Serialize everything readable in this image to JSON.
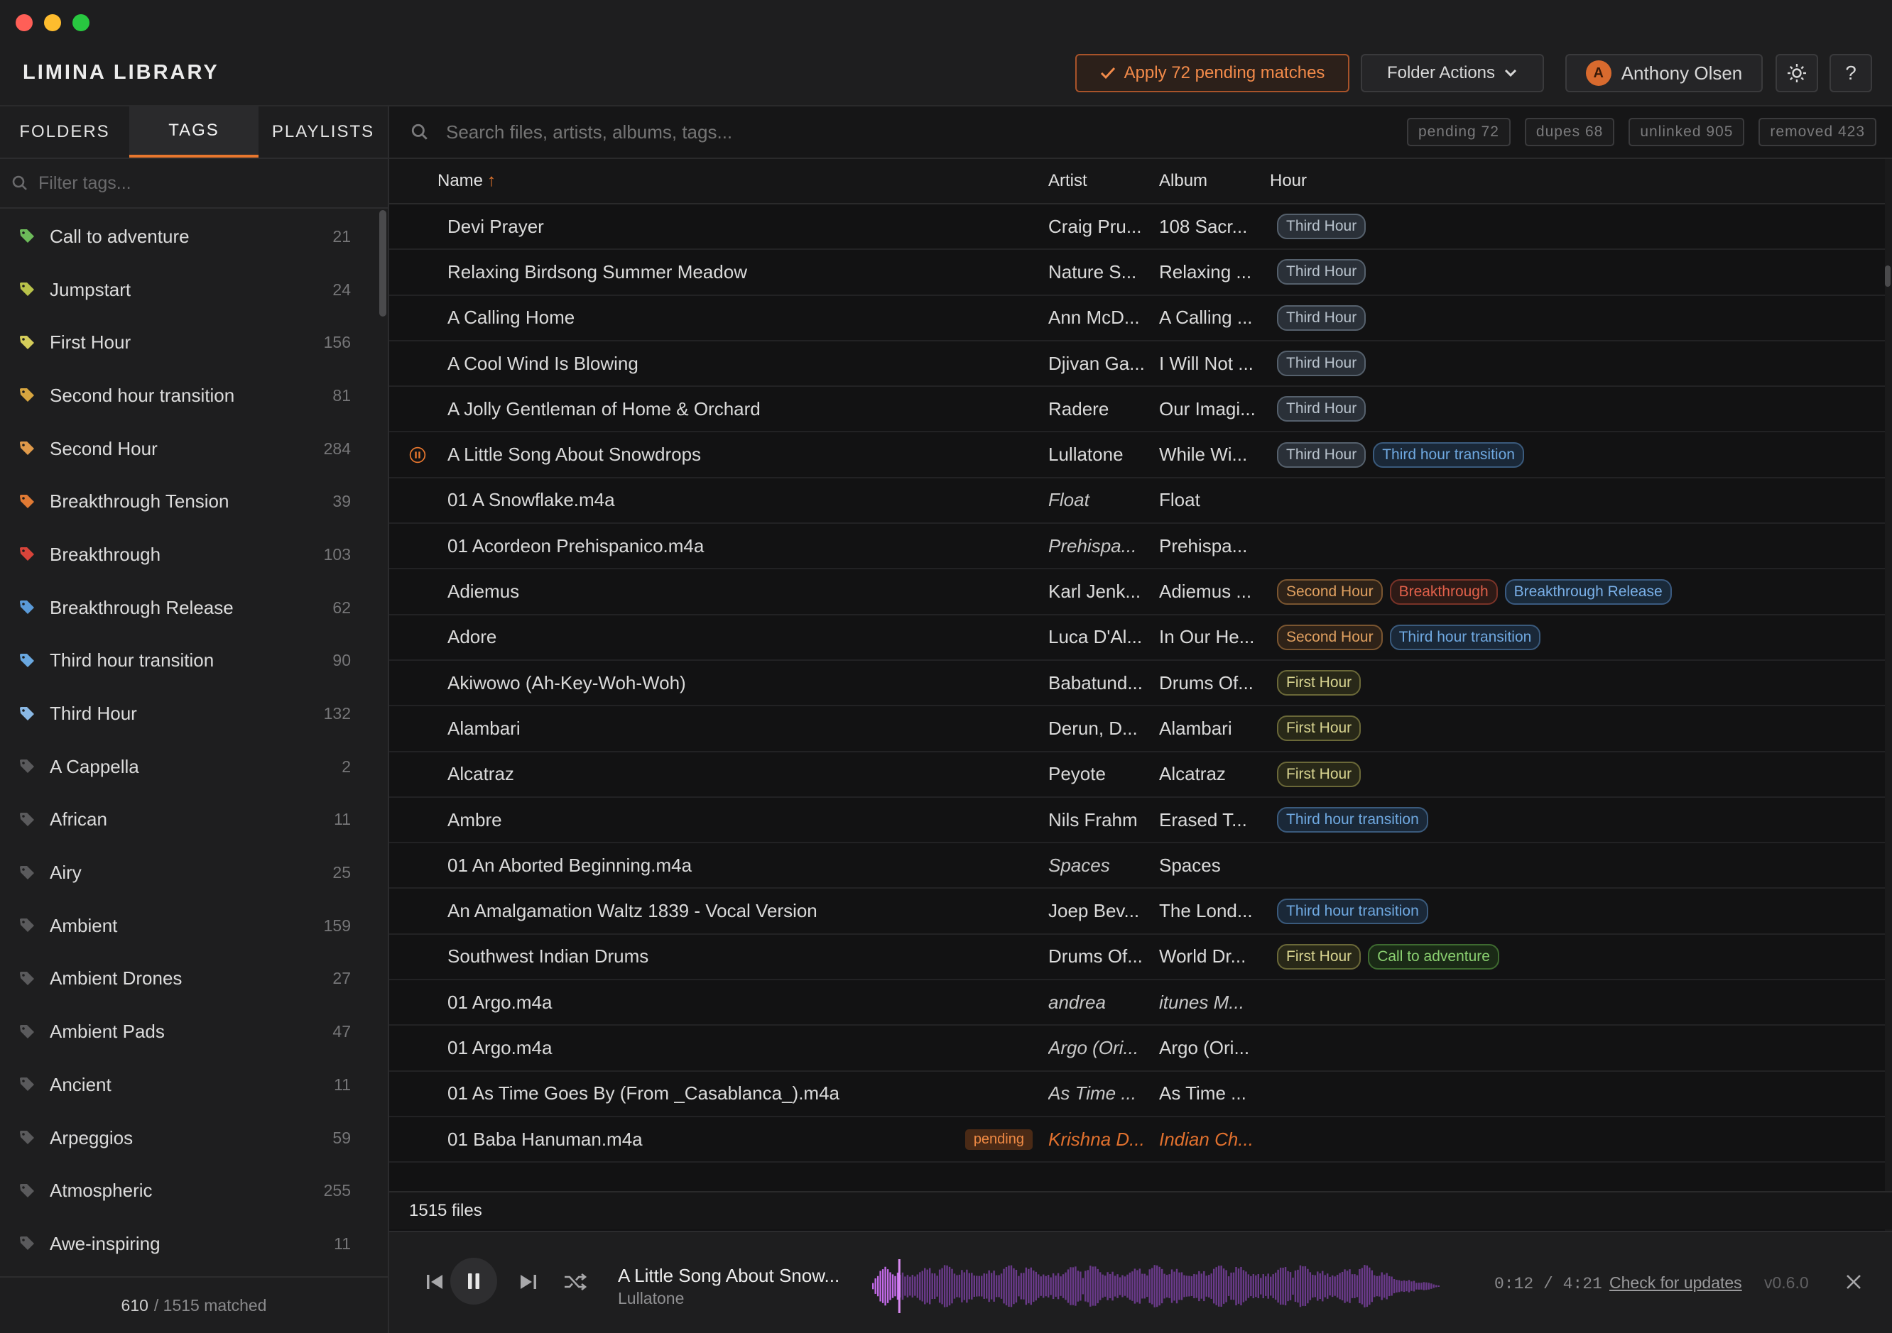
{
  "app": {
    "title": "LIMINA LIBRARY",
    "apply_label": "Apply 72 pending matches",
    "folder_actions_label": "Folder Actions",
    "user_name": "Anthony Olsen",
    "user_initial": "A",
    "help_label": "?"
  },
  "sidebar": {
    "tabs": [
      {
        "label": "FOLDERS",
        "active": false
      },
      {
        "label": "TAGS",
        "active": true
      },
      {
        "label": "PLAYLISTS",
        "active": false
      }
    ],
    "filter_placeholder": "Filter tags...",
    "tags": [
      {
        "label": "Call to adventure",
        "count": "21",
        "color": "#6dbb5a"
      },
      {
        "label": "Jumpstart",
        "count": "24",
        "color": "#b8c24a"
      },
      {
        "label": "First Hour",
        "count": "156",
        "color": "#d4cc5a"
      },
      {
        "label": "Second hour transition",
        "count": "81",
        "color": "#d8a640"
      },
      {
        "label": "Second Hour",
        "count": "284",
        "color": "#e09a4a"
      },
      {
        "label": "Breakthrough Tension",
        "count": "39",
        "color": "#e07a34"
      },
      {
        "label": "Breakthrough",
        "count": "103",
        "color": "#d8443a"
      },
      {
        "label": "Breakthrough Release",
        "count": "62",
        "color": "#5a9ad8"
      },
      {
        "label": "Third hour transition",
        "count": "90",
        "color": "#6aa8e0"
      },
      {
        "label": "Third Hour",
        "count": "132",
        "color": "#8ab8e4"
      },
      {
        "label": "A Cappella",
        "count": "2",
        "color": "#5a5a5c"
      },
      {
        "label": "African",
        "count": "11",
        "color": "#5a5a5c"
      },
      {
        "label": "Airy",
        "count": "25",
        "color": "#5a5a5c"
      },
      {
        "label": "Ambient",
        "count": "159",
        "color": "#5a5a5c"
      },
      {
        "label": "Ambient Drones",
        "count": "27",
        "color": "#5a5a5c"
      },
      {
        "label": "Ambient Pads",
        "count": "47",
        "color": "#5a5a5c"
      },
      {
        "label": "Ancient",
        "count": "11",
        "color": "#5a5a5c"
      },
      {
        "label": "Arpeggios",
        "count": "59",
        "color": "#5a5a5c"
      },
      {
        "label": "Atmospheric",
        "count": "255",
        "color": "#5a5a5c"
      },
      {
        "label": "Awe-inspiring",
        "count": "11",
        "color": "#5a5a5c"
      }
    ],
    "footer_matched": "610",
    "footer_total": "/ 1515 matched"
  },
  "search": {
    "placeholder": "Search files, artists, albums, tags...",
    "stats": [
      "pending 72",
      "dupes 68",
      "unlinked 905",
      "removed 423"
    ]
  },
  "table": {
    "columns": {
      "name": "Name",
      "artist": "Artist",
      "album": "Album",
      "hour": "Hour"
    },
    "sort_indicator": "↑",
    "rows": [
      {
        "name": "Devi Prayer",
        "artist": "Craig Pru...",
        "album": "108 Sacr...",
        "tags": [
          [
            "Third Hour",
            "p-third"
          ]
        ]
      },
      {
        "name": "Relaxing Birdsong Summer Meadow",
        "artist": "Nature S...",
        "album": "Relaxing ...",
        "tags": [
          [
            "Third Hour",
            "p-third"
          ]
        ]
      },
      {
        "name": "A Calling Home",
        "artist": "Ann McD...",
        "album": "A Calling ...",
        "tags": [
          [
            "Third Hour",
            "p-third"
          ]
        ]
      },
      {
        "name": "A Cool Wind Is Blowing",
        "artist": "Djivan Ga...",
        "album": "I Will Not ...",
        "tags": [
          [
            "Third Hour",
            "p-third"
          ]
        ]
      },
      {
        "name": "A Jolly Gentleman of Home & Orchard",
        "artist": "Radere",
        "album": "Our Imagi...",
        "tags": [
          [
            "Third Hour",
            "p-third"
          ]
        ]
      },
      {
        "name": "A Little Song About Snowdrops",
        "artist": "Lullatone",
        "album": "While Wi...",
        "playing": true,
        "tags": [
          [
            "Third Hour",
            "p-third"
          ],
          [
            "Third hour transition",
            "p-tht"
          ]
        ]
      },
      {
        "name": "01 A Snowflake.m4a",
        "artist": "Float",
        "album": "Float",
        "artist_italic": true,
        "tags": []
      },
      {
        "name": "01 Acordeon Prehispanico.m4a",
        "artist": "Prehispa...",
        "album": "Prehispa...",
        "artist_italic": true,
        "tags": []
      },
      {
        "name": "Adiemus",
        "artist": "Karl Jenk...",
        "album": "Adiemus ...",
        "tags": [
          [
            "Second Hour",
            "p-second"
          ],
          [
            "Breakthrough",
            "p-break"
          ],
          [
            "Breakthrough Release",
            "p-brel"
          ]
        ]
      },
      {
        "name": "Adore",
        "artist": "Luca D'Al...",
        "album": "In Our He...",
        "tags": [
          [
            "Second Hour",
            "p-second"
          ],
          [
            "Third hour transition",
            "p-tht"
          ]
        ]
      },
      {
        "name": "Akiwowo (Ah-Key-Woh-Woh)",
        "artist": "Babatund...",
        "album": "Drums Of...",
        "tags": [
          [
            "First Hour",
            "p-first"
          ]
        ]
      },
      {
        "name": "Alambari",
        "artist": "Derun, D...",
        "album": "Alambari",
        "tags": [
          [
            "First Hour",
            "p-first"
          ]
        ]
      },
      {
        "name": "Alcatraz",
        "artist": "Peyote",
        "album": "Alcatraz",
        "tags": [
          [
            "First Hour",
            "p-first"
          ]
        ]
      },
      {
        "name": "Ambre",
        "artist": "Nils Frahm",
        "album": "Erased T...",
        "tags": [
          [
            "Third hour transition",
            "p-tht"
          ]
        ]
      },
      {
        "name": "01 An Aborted Beginning.m4a",
        "artist": "Spaces",
        "album": "Spaces",
        "artist_italic": true,
        "tags": []
      },
      {
        "name": "An Amalgamation Waltz 1839 - Vocal Version",
        "artist": "Joep Bev...",
        "album": "The Lond...",
        "tags": [
          [
            "Third hour transition",
            "p-tht"
          ]
        ]
      },
      {
        "name": "Southwest Indian Drums",
        "artist": "Drums Of...",
        "album": "World Dr...",
        "tags": [
          [
            "First Hour",
            "p-first"
          ],
          [
            "Call to adventure",
            "p-call"
          ]
        ]
      },
      {
        "name": "01 Argo.m4a",
        "artist": "andrea",
        "album": "itunes M...",
        "artist_italic": true,
        "album_italic": true,
        "tags": []
      },
      {
        "name": "01 Argo.m4a",
        "artist": "Argo (Ori...",
        "album": "Argo (Ori...",
        "artist_italic": true,
        "tags": []
      },
      {
        "name": "01 As Time Goes By (From _Casablanca_).m4a",
        "artist": "As Time ...",
        "album": "As Time ...",
        "artist_italic": true,
        "tags": []
      },
      {
        "name": "01 Baba Hanuman.m4a",
        "artist": "Krishna D...",
        "album": "Indian Ch...",
        "pending": "pending",
        "tags": []
      }
    ],
    "file_count": "1515 files"
  },
  "player": {
    "title": "A Little Song About Snow...",
    "artist": "Lullatone",
    "time": "0:12 / 4:21",
    "progress": 0.046,
    "updates_label": "Check for updates",
    "version": "v0.6.0"
  }
}
